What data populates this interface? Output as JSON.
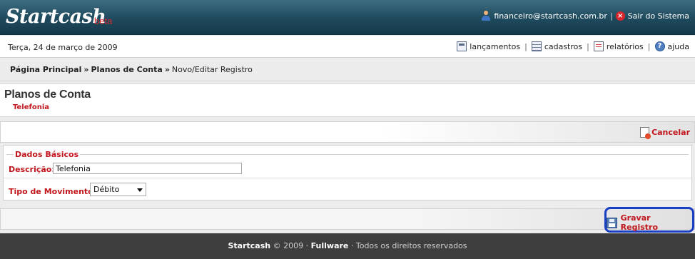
{
  "header": {
    "logo": "Startcash",
    "logo_tag": "beta",
    "user_email": "financeiro@startcash.com.br",
    "separator": "|",
    "logout_label": "Sair do Sistema"
  },
  "datebar": {
    "date": "Terça, 24 de março de 2009",
    "menu": [
      {
        "label": "lançamentos",
        "icon": "calculator-icon"
      },
      {
        "label": "cadastros",
        "icon": "table-icon"
      },
      {
        "label": "relatórios",
        "icon": "report-icon"
      },
      {
        "label": "ajuda",
        "icon": "help-icon"
      }
    ]
  },
  "breadcrumb": {
    "home": "Página Principal",
    "section": "Planos de Conta",
    "current": "Novo/Editar Registro",
    "sep": "»"
  },
  "page": {
    "title": "Planos de Conta",
    "subtitle": "Telefonia"
  },
  "actions": {
    "cancel_label": "Cancelar"
  },
  "form": {
    "legend": "Dados Básicos",
    "descricao_label": "Descrição:",
    "descricao_value": "Telefonia",
    "tipo_label": "Tipo de Movimento:",
    "tipo_value": "Débito"
  },
  "save": {
    "label": "Gravar Registro"
  },
  "footer": {
    "brand": "Startcash",
    "copy": "© 2009 ·",
    "company": "Fullware",
    "rights": "· Todos os direitos reservados"
  },
  "colors": {
    "accent_red": "#c0161c",
    "header_teal": "#1f4a5d",
    "highlight_blue": "#1a3fc2",
    "footer_dark": "#3e3e3e"
  }
}
